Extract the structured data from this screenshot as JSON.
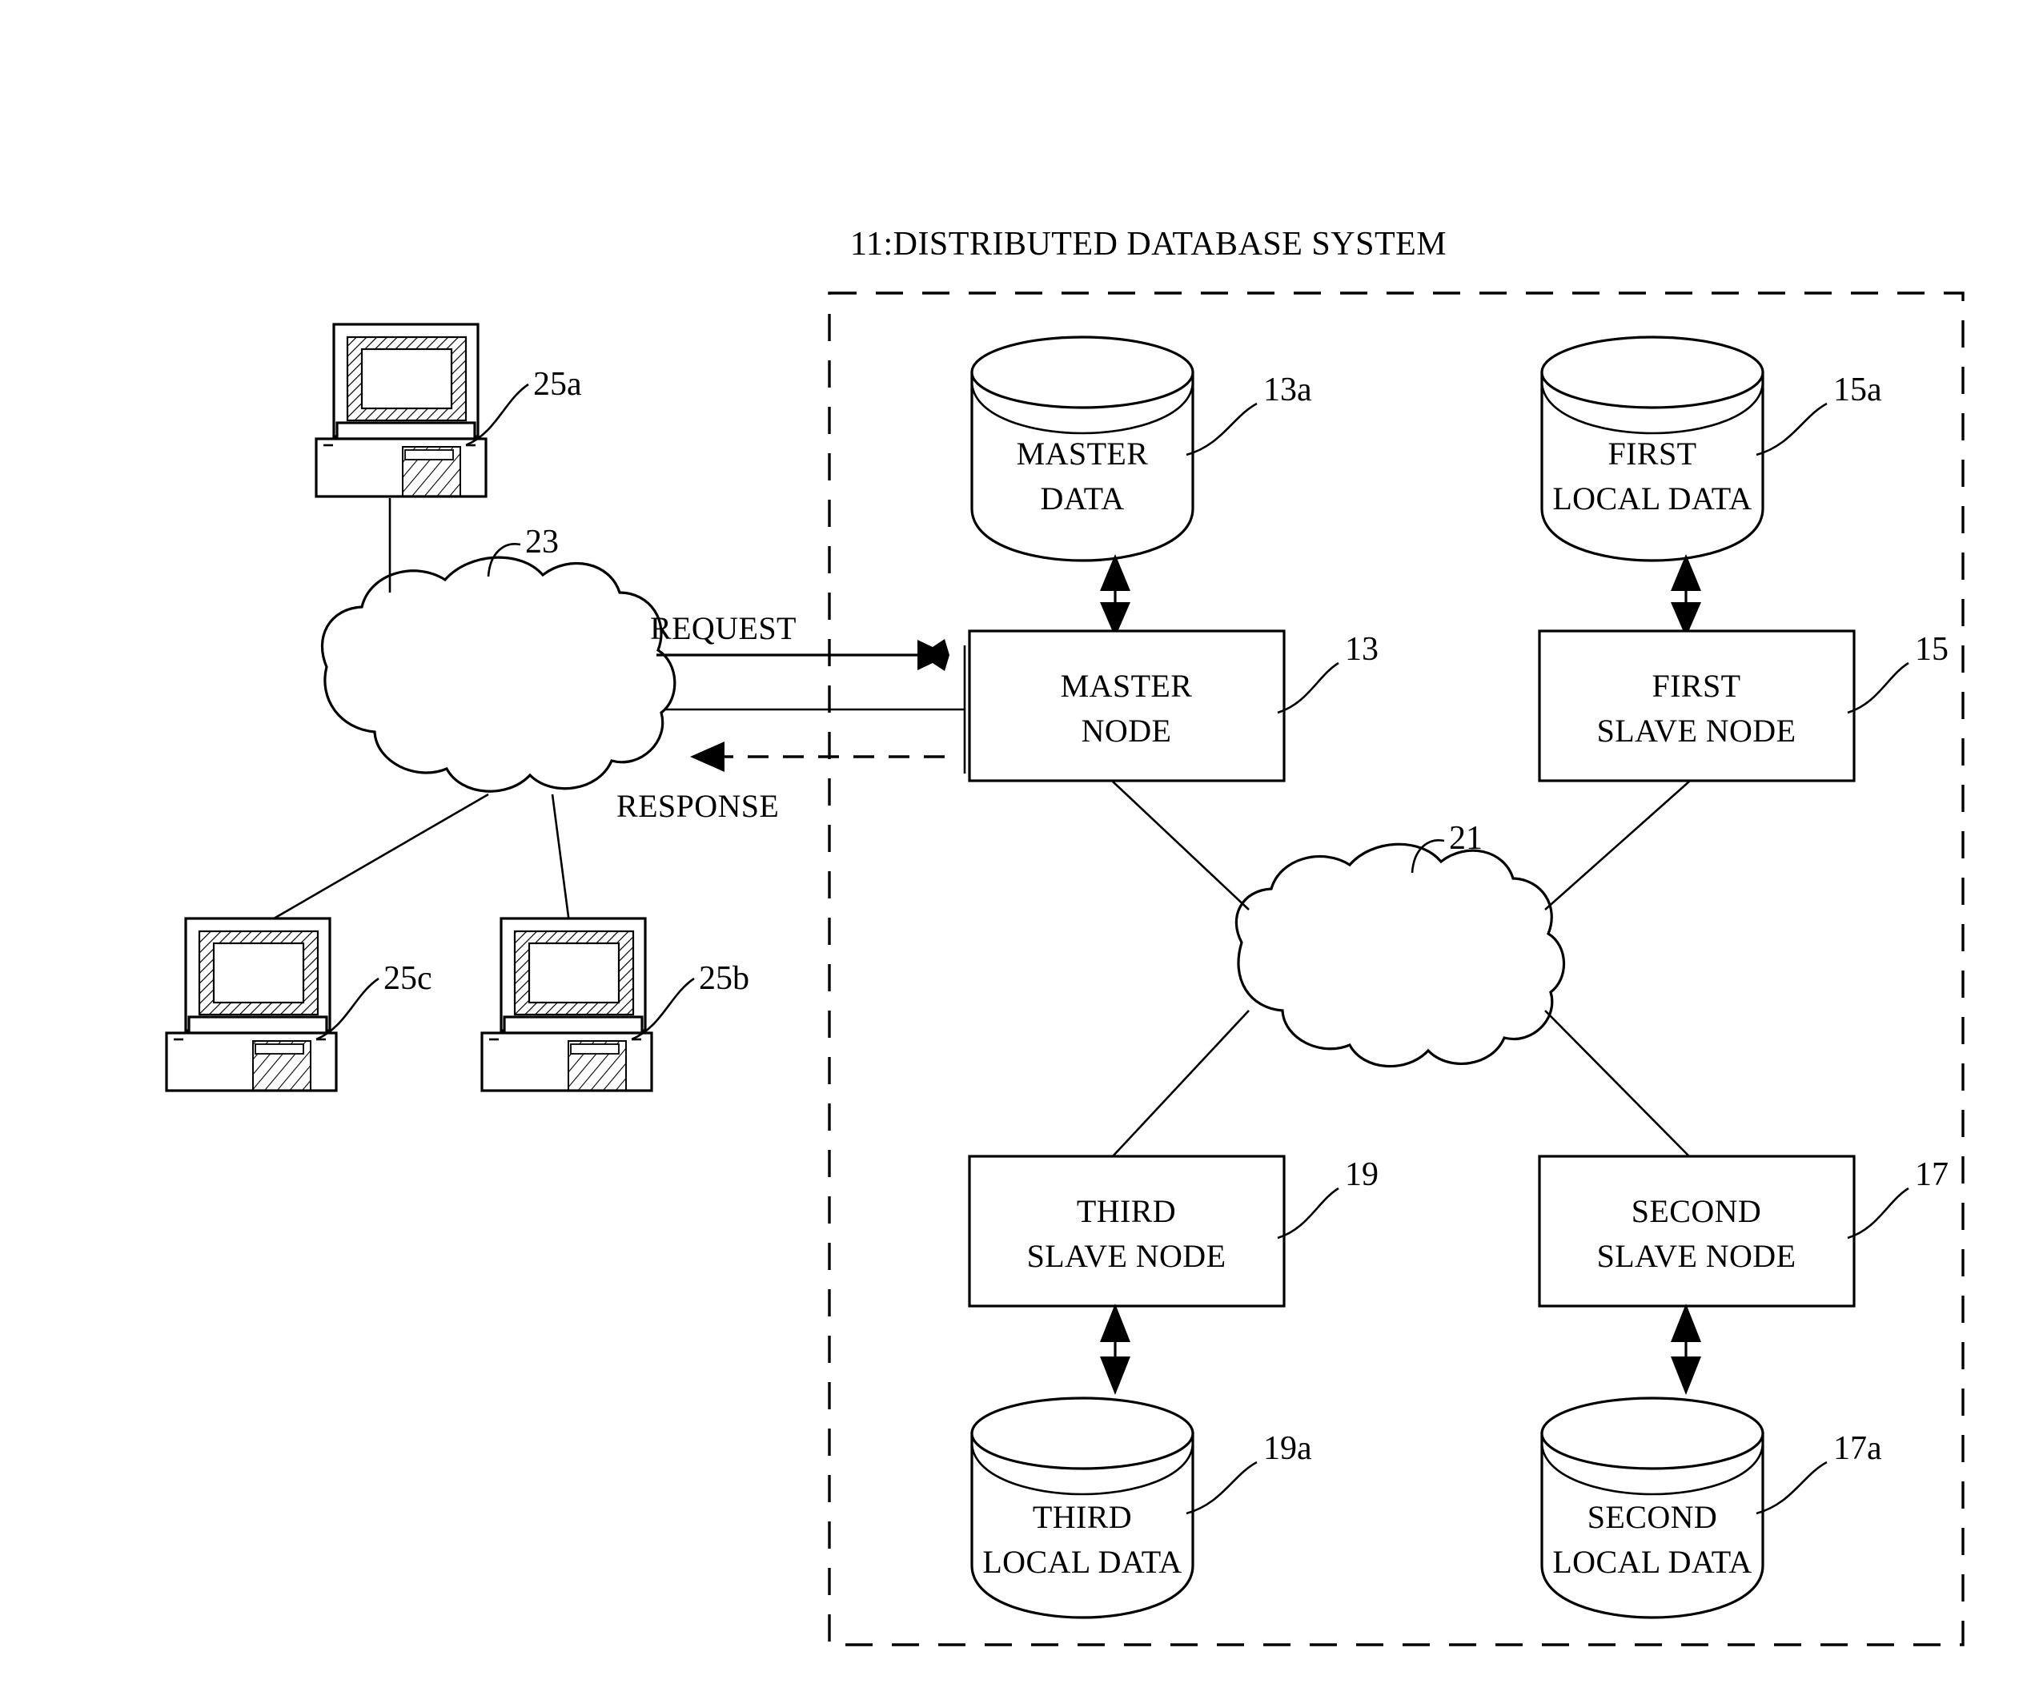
{
  "figure": {
    "title": "11:DISTRIBUTED DATABASE SYSTEM",
    "type": "patent-diagram",
    "background_color": "#ffffff",
    "line_color": "#000000"
  },
  "system_boundary": {
    "label": "11",
    "style": "dashed-rectangle",
    "name": "distributed-database-system-boundary"
  },
  "networks": [
    {
      "id": "cloud-23",
      "ref": "23",
      "shape": "cloud",
      "location": "left-external-network"
    },
    {
      "id": "cloud-21",
      "ref": "21",
      "shape": "cloud",
      "location": "internal-network"
    }
  ],
  "clients": [
    {
      "id": "client-25a",
      "ref": "25a",
      "icon": "desktop-computer-icon"
    },
    {
      "id": "client-25c",
      "ref": "25c",
      "icon": "desktop-computer-icon"
    },
    {
      "id": "client-25b",
      "ref": "25b",
      "icon": "desktop-computer-icon"
    }
  ],
  "nodes": [
    {
      "id": "master-node",
      "ref": "13",
      "line1": "MASTER",
      "line2": "NODE"
    },
    {
      "id": "first-slave-node",
      "ref": "15",
      "line1": "FIRST",
      "line2": "SLAVE NODE"
    },
    {
      "id": "third-slave-node",
      "ref": "19",
      "line1": "THIRD",
      "line2": "SLAVE NODE"
    },
    {
      "id": "second-slave-node",
      "ref": "17",
      "line1": "SECOND",
      "line2": "SLAVE NODE"
    }
  ],
  "datastores": [
    {
      "id": "master-data",
      "ref": "13a",
      "line1": "MASTER",
      "line2": "DATA"
    },
    {
      "id": "first-local-data",
      "ref": "15a",
      "line1": "FIRST",
      "line2": "LOCAL DATA"
    },
    {
      "id": "third-local-data",
      "ref": "19a",
      "line1": "THIRD",
      "line2": "LOCAL DATA"
    },
    {
      "id": "second-local-data",
      "ref": "17a",
      "line1": "SECOND",
      "line2": "LOCAL DATA"
    }
  ],
  "flows": [
    {
      "id": "request-flow",
      "label": "REQUEST",
      "style": "solid",
      "direction": "right"
    },
    {
      "id": "response-flow",
      "label": "RESPONSE",
      "style": "dashed",
      "direction": "left"
    }
  ]
}
